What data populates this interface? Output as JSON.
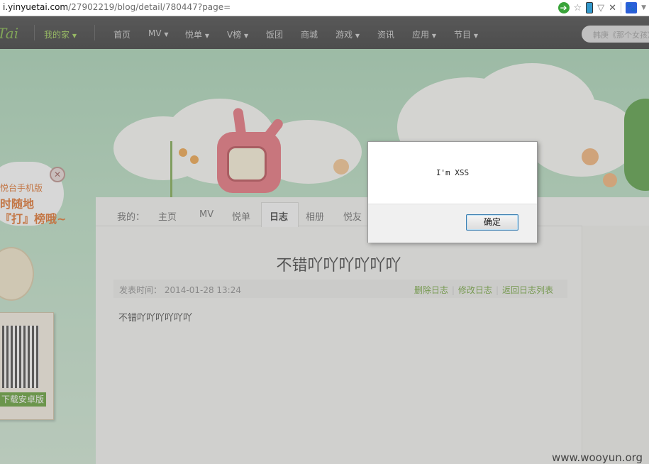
{
  "browser": {
    "url_scheme_hint": "i.yinyuetai.com",
    "url_rest": "/27902219/blog/detail/780447?page="
  },
  "site": {
    "logo": "Tai",
    "my_home": "我的家",
    "nav": [
      "首页",
      "MV",
      "悦单",
      "V榜",
      "饭团",
      "商城",
      "游戏",
      "资讯",
      "应用",
      "节目"
    ],
    "search_placeholder": "韩庚《那个女孩》"
  },
  "promo": {
    "line1": "悦台手机版",
    "line2": "时随地",
    "line3": "『打』榜哦~",
    "download_button": "下载安卓版"
  },
  "subnav": {
    "label": "我的：",
    "tabs": [
      "主页",
      "MV",
      "悦单",
      "日志",
      "相册",
      "悦友"
    ],
    "active": "日志"
  },
  "post": {
    "title": "不错吖吖吖吖吖吖",
    "time_label": "发表时间：",
    "time_value": "2014-01-28 13:24",
    "actions": [
      "删除日志",
      "修改日志",
      "返回日志列表"
    ],
    "body": "不错吖吖吖吖吖吖"
  },
  "dialog": {
    "message": "I'm XSS",
    "ok_label": "确定"
  },
  "watermark": "www.wooyun.org"
}
